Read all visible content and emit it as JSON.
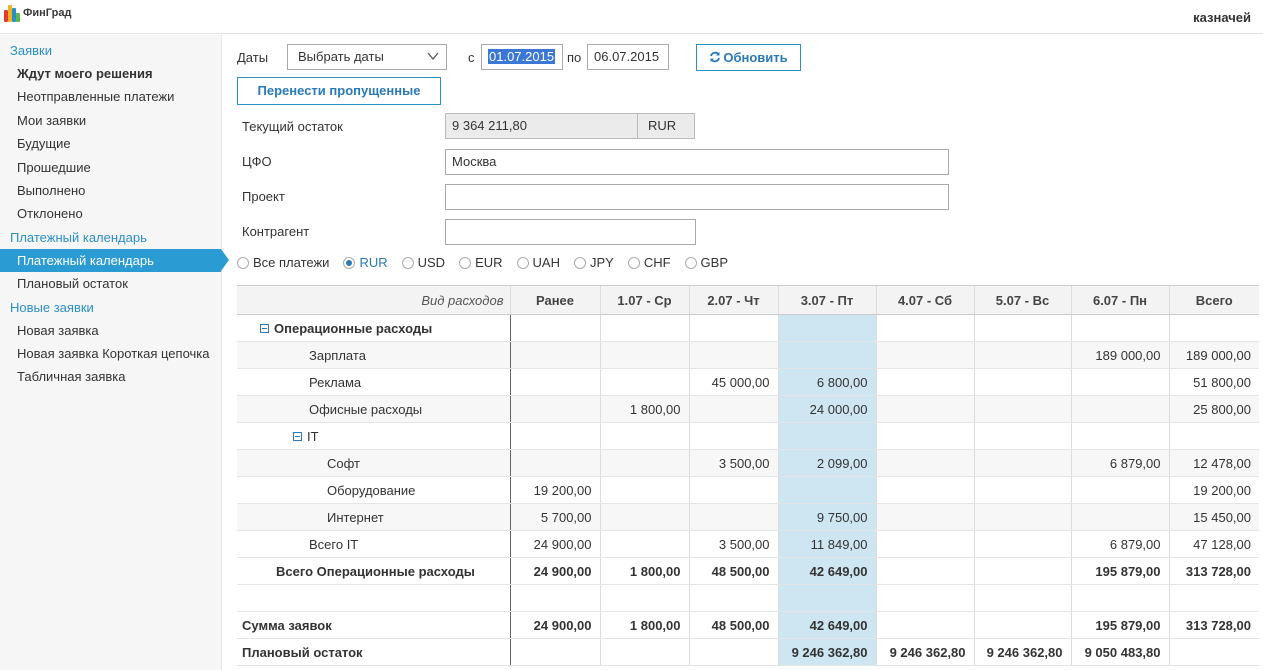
{
  "app": {
    "logo_text": "ФинГрад",
    "user": "казначей"
  },
  "sidebar": {
    "groups": [
      {
        "title": "Заявки",
        "items": [
          "Ждут моего решения",
          "Неотправленные платежи",
          "Мои заявки",
          "Будущие",
          "Прошедшие",
          "Выполнено",
          "Отклонено"
        ]
      },
      {
        "title": "Платежный календарь",
        "items": [
          "Платежный календарь",
          "Плановый остаток"
        ]
      },
      {
        "title": "Новые заявки",
        "items": [
          "Новая заявка",
          "Новая заявка Короткая цепочка",
          "Табличная заявка"
        ]
      }
    ]
  },
  "filters": {
    "dates_label": "Даты",
    "dates_select": "Выбрать даты",
    "from_label": "с",
    "from_value": "01.07.2015",
    "to_label": "по",
    "to_value": "06.07.2015",
    "refresh_label": "Обновить",
    "transfer_label": "Перенести пропущенные",
    "balance_label": "Текущий остаток",
    "balance_value": "9 364 211,80",
    "balance_currency": "RUR",
    "cfo_label": "ЦФО",
    "cfo_value": "Москва",
    "project_label": "Проект",
    "project_value": "",
    "counterparty_label": "Контрагент",
    "counterparty_value": ""
  },
  "currencies": [
    "Все платежи",
    "RUR",
    "USD",
    "EUR",
    "UAH",
    "JPY",
    "CHF",
    "GBP"
  ],
  "currency_selected": "RUR",
  "table": {
    "headers": [
      "Вид расходов",
      "Ранее",
      "1.07 - Ср",
      "2.07 - Чт",
      "3.07 - Пт",
      "4.07 - Сб",
      "5.07 - Вс",
      "6.07 - Пн",
      "Всего"
    ],
    "rows": [
      {
        "name": "Операционные расходы",
        "indent": 1,
        "toggle": true,
        "bold": true,
        "cells": [
          "",
          "",
          "",
          "",
          "",
          "",
          "",
          ""
        ]
      },
      {
        "name": "Зарплата",
        "indent": 2,
        "cells": [
          "",
          "",
          "",
          "",
          "",
          "",
          "189 000,00",
          "189 000,00"
        ]
      },
      {
        "name": "Реклама",
        "indent": 2,
        "cells": [
          "",
          "",
          "45 000,00",
          "6 800,00",
          "",
          "",
          "",
          "51 800,00"
        ]
      },
      {
        "name": "Офисные расходы",
        "indent": 2,
        "cells": [
          "",
          "1 800,00",
          "",
          "24 000,00",
          "",
          "",
          "",
          "25 800,00"
        ]
      },
      {
        "name": "IT",
        "indent": 2,
        "toggle": true,
        "cells": [
          "",
          "",
          "",
          "",
          "",
          "",
          "",
          ""
        ]
      },
      {
        "name": "Софт",
        "indent": 3,
        "cells": [
          "",
          "",
          "3 500,00",
          "2 099,00",
          "",
          "",
          "6 879,00",
          "12 478,00"
        ]
      },
      {
        "name": "Оборудование",
        "indent": 3,
        "cells": [
          "19 200,00",
          "",
          "",
          "",
          "",
          "",
          "",
          "19 200,00"
        ]
      },
      {
        "name": "Интернет",
        "indent": 3,
        "cells": [
          "5 700,00",
          "",
          "",
          "9 750,00",
          "",
          "",
          "",
          "15 450,00"
        ]
      },
      {
        "name": "Всего IT",
        "indent": 2,
        "cells": [
          "24 900,00",
          "",
          "3 500,00",
          "11 849,00",
          "",
          "",
          "6 879,00",
          "47 128,00"
        ]
      },
      {
        "name": "Всего Операционные расходы",
        "indent": 1,
        "bold": true,
        "cells": [
          "24 900,00",
          "1 800,00",
          "48 500,00",
          "42 649,00",
          "",
          "",
          "195 879,00",
          "313 728,00"
        ]
      },
      {
        "name": "",
        "indent": 0,
        "cells": [
          "",
          "",
          "",
          "",
          "",
          "",
          "",
          ""
        ]
      },
      {
        "name": "Сумма заявок",
        "indent": 0,
        "bold": true,
        "cells": [
          "24 900,00",
          "1 800,00",
          "48 500,00",
          "42 649,00",
          "",
          "",
          "195 879,00",
          "313 728,00"
        ]
      },
      {
        "name": "Плановый остаток",
        "indent": 0,
        "bold": true,
        "cells": [
          "",
          "",
          "",
          "9 246 362,80",
          "9 246 362,80",
          "9 246 362,80",
          "9 050 483,80",
          ""
        ]
      }
    ]
  }
}
